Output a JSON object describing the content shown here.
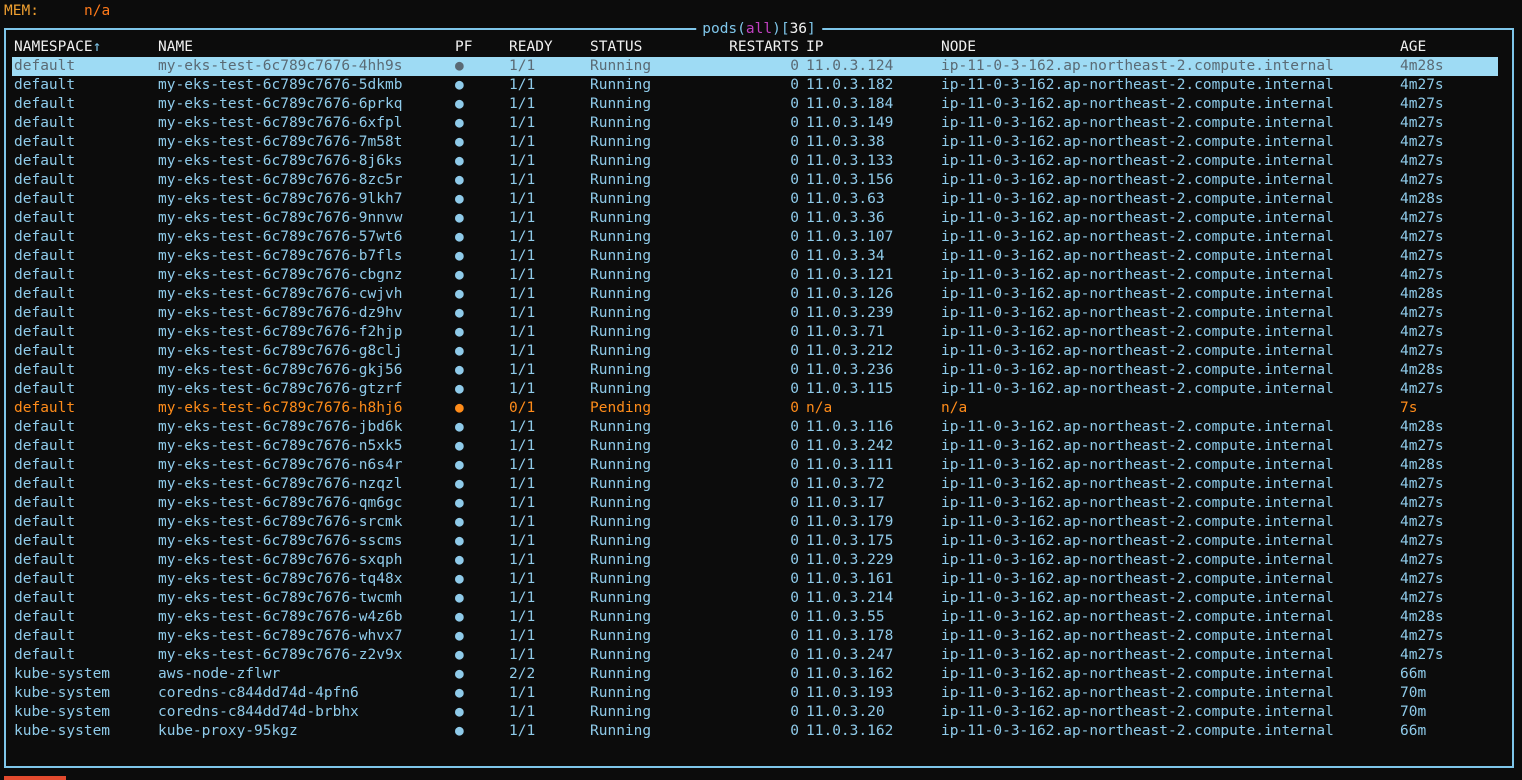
{
  "mem": {
    "label": "MEM:",
    "value": "n/a"
  },
  "title": {
    "resource": "pods",
    "open_paren": "(",
    "scope": "all",
    "close_paren": ")",
    "count_open": "[",
    "count": "36",
    "count_close": "]"
  },
  "colors": {
    "border": "#7fc6ea",
    "running": "#8fcbea",
    "pending": "#ff8c1a",
    "selected_bg": "#9edbf4"
  },
  "columns": {
    "namespace": "NAMESPACE",
    "sort_indicator": "↑",
    "name": "NAME",
    "pf": "PF",
    "ready": "READY",
    "status": "STATUS",
    "restarts": "RESTARTS",
    "ip": "IP",
    "node": "NODE",
    "age": "AGE"
  },
  "pods": [
    {
      "ns": "default",
      "name": "my-eks-test-6c789c7676-4hh9s",
      "pf": "●",
      "ready": "1/1",
      "status": "Running",
      "restarts": "0",
      "ip": "11.0.3.124",
      "node": "ip-11-0-3-162.ap-northeast-2.compute.internal",
      "age": "4m28s",
      "state": "selected"
    },
    {
      "ns": "default",
      "name": "my-eks-test-6c789c7676-5dkmb",
      "pf": "●",
      "ready": "1/1",
      "status": "Running",
      "restarts": "0",
      "ip": "11.0.3.182",
      "node": "ip-11-0-3-162.ap-northeast-2.compute.internal",
      "age": "4m27s",
      "state": "running"
    },
    {
      "ns": "default",
      "name": "my-eks-test-6c789c7676-6prkq",
      "pf": "●",
      "ready": "1/1",
      "status": "Running",
      "restarts": "0",
      "ip": "11.0.3.184",
      "node": "ip-11-0-3-162.ap-northeast-2.compute.internal",
      "age": "4m27s",
      "state": "running"
    },
    {
      "ns": "default",
      "name": "my-eks-test-6c789c7676-6xfpl",
      "pf": "●",
      "ready": "1/1",
      "status": "Running",
      "restarts": "0",
      "ip": "11.0.3.149",
      "node": "ip-11-0-3-162.ap-northeast-2.compute.internal",
      "age": "4m27s",
      "state": "running"
    },
    {
      "ns": "default",
      "name": "my-eks-test-6c789c7676-7m58t",
      "pf": "●",
      "ready": "1/1",
      "status": "Running",
      "restarts": "0",
      "ip": "11.0.3.38",
      "node": "ip-11-0-3-162.ap-northeast-2.compute.internal",
      "age": "4m27s",
      "state": "running"
    },
    {
      "ns": "default",
      "name": "my-eks-test-6c789c7676-8j6ks",
      "pf": "●",
      "ready": "1/1",
      "status": "Running",
      "restarts": "0",
      "ip": "11.0.3.133",
      "node": "ip-11-0-3-162.ap-northeast-2.compute.internal",
      "age": "4m27s",
      "state": "running"
    },
    {
      "ns": "default",
      "name": "my-eks-test-6c789c7676-8zc5r",
      "pf": "●",
      "ready": "1/1",
      "status": "Running",
      "restarts": "0",
      "ip": "11.0.3.156",
      "node": "ip-11-0-3-162.ap-northeast-2.compute.internal",
      "age": "4m27s",
      "state": "running"
    },
    {
      "ns": "default",
      "name": "my-eks-test-6c789c7676-9lkh7",
      "pf": "●",
      "ready": "1/1",
      "status": "Running",
      "restarts": "0",
      "ip": "11.0.3.63",
      "node": "ip-11-0-3-162.ap-northeast-2.compute.internal",
      "age": "4m28s",
      "state": "running"
    },
    {
      "ns": "default",
      "name": "my-eks-test-6c789c7676-9nnvw",
      "pf": "●",
      "ready": "1/1",
      "status": "Running",
      "restarts": "0",
      "ip": "11.0.3.36",
      "node": "ip-11-0-3-162.ap-northeast-2.compute.internal",
      "age": "4m27s",
      "state": "running"
    },
    {
      "ns": "default",
      "name": "my-eks-test-6c789c7676-57wt6",
      "pf": "●",
      "ready": "1/1",
      "status": "Running",
      "restarts": "0",
      "ip": "11.0.3.107",
      "node": "ip-11-0-3-162.ap-northeast-2.compute.internal",
      "age": "4m27s",
      "state": "running"
    },
    {
      "ns": "default",
      "name": "my-eks-test-6c789c7676-b7fls",
      "pf": "●",
      "ready": "1/1",
      "status": "Running",
      "restarts": "0",
      "ip": "11.0.3.34",
      "node": "ip-11-0-3-162.ap-northeast-2.compute.internal",
      "age": "4m27s",
      "state": "running"
    },
    {
      "ns": "default",
      "name": "my-eks-test-6c789c7676-cbgnz",
      "pf": "●",
      "ready": "1/1",
      "status": "Running",
      "restarts": "0",
      "ip": "11.0.3.121",
      "node": "ip-11-0-3-162.ap-northeast-2.compute.internal",
      "age": "4m27s",
      "state": "running"
    },
    {
      "ns": "default",
      "name": "my-eks-test-6c789c7676-cwjvh",
      "pf": "●",
      "ready": "1/1",
      "status": "Running",
      "restarts": "0",
      "ip": "11.0.3.126",
      "node": "ip-11-0-3-162.ap-northeast-2.compute.internal",
      "age": "4m28s",
      "state": "running"
    },
    {
      "ns": "default",
      "name": "my-eks-test-6c789c7676-dz9hv",
      "pf": "●",
      "ready": "1/1",
      "status": "Running",
      "restarts": "0",
      "ip": "11.0.3.239",
      "node": "ip-11-0-3-162.ap-northeast-2.compute.internal",
      "age": "4m27s",
      "state": "running"
    },
    {
      "ns": "default",
      "name": "my-eks-test-6c789c7676-f2hjp",
      "pf": "●",
      "ready": "1/1",
      "status": "Running",
      "restarts": "0",
      "ip": "11.0.3.71",
      "node": "ip-11-0-3-162.ap-northeast-2.compute.internal",
      "age": "4m27s",
      "state": "running"
    },
    {
      "ns": "default",
      "name": "my-eks-test-6c789c7676-g8clj",
      "pf": "●",
      "ready": "1/1",
      "status": "Running",
      "restarts": "0",
      "ip": "11.0.3.212",
      "node": "ip-11-0-3-162.ap-northeast-2.compute.internal",
      "age": "4m27s",
      "state": "running"
    },
    {
      "ns": "default",
      "name": "my-eks-test-6c789c7676-gkj56",
      "pf": "●",
      "ready": "1/1",
      "status": "Running",
      "restarts": "0",
      "ip": "11.0.3.236",
      "node": "ip-11-0-3-162.ap-northeast-2.compute.internal",
      "age": "4m28s",
      "state": "running"
    },
    {
      "ns": "default",
      "name": "my-eks-test-6c789c7676-gtzrf",
      "pf": "●",
      "ready": "1/1",
      "status": "Running",
      "restarts": "0",
      "ip": "11.0.3.115",
      "node": "ip-11-0-3-162.ap-northeast-2.compute.internal",
      "age": "4m27s",
      "state": "running"
    },
    {
      "ns": "default",
      "name": "my-eks-test-6c789c7676-h8hj6",
      "pf": "●",
      "ready": "0/1",
      "status": "Pending",
      "restarts": "0",
      "ip": "n/a",
      "node": "n/a",
      "age": "7s",
      "state": "pending"
    },
    {
      "ns": "default",
      "name": "my-eks-test-6c789c7676-jbd6k",
      "pf": "●",
      "ready": "1/1",
      "status": "Running",
      "restarts": "0",
      "ip": "11.0.3.116",
      "node": "ip-11-0-3-162.ap-northeast-2.compute.internal",
      "age": "4m28s",
      "state": "running"
    },
    {
      "ns": "default",
      "name": "my-eks-test-6c789c7676-n5xk5",
      "pf": "●",
      "ready": "1/1",
      "status": "Running",
      "restarts": "0",
      "ip": "11.0.3.242",
      "node": "ip-11-0-3-162.ap-northeast-2.compute.internal",
      "age": "4m27s",
      "state": "running"
    },
    {
      "ns": "default",
      "name": "my-eks-test-6c789c7676-n6s4r",
      "pf": "●",
      "ready": "1/1",
      "status": "Running",
      "restarts": "0",
      "ip": "11.0.3.111",
      "node": "ip-11-0-3-162.ap-northeast-2.compute.internal",
      "age": "4m28s",
      "state": "running"
    },
    {
      "ns": "default",
      "name": "my-eks-test-6c789c7676-nzqzl",
      "pf": "●",
      "ready": "1/1",
      "status": "Running",
      "restarts": "0",
      "ip": "11.0.3.72",
      "node": "ip-11-0-3-162.ap-northeast-2.compute.internal",
      "age": "4m27s",
      "state": "running"
    },
    {
      "ns": "default",
      "name": "my-eks-test-6c789c7676-qm6gc",
      "pf": "●",
      "ready": "1/1",
      "status": "Running",
      "restarts": "0",
      "ip": "11.0.3.17",
      "node": "ip-11-0-3-162.ap-northeast-2.compute.internal",
      "age": "4m27s",
      "state": "running"
    },
    {
      "ns": "default",
      "name": "my-eks-test-6c789c7676-srcmk",
      "pf": "●",
      "ready": "1/1",
      "status": "Running",
      "restarts": "0",
      "ip": "11.0.3.179",
      "node": "ip-11-0-3-162.ap-northeast-2.compute.internal",
      "age": "4m27s",
      "state": "running"
    },
    {
      "ns": "default",
      "name": "my-eks-test-6c789c7676-sscms",
      "pf": "●",
      "ready": "1/1",
      "status": "Running",
      "restarts": "0",
      "ip": "11.0.3.175",
      "node": "ip-11-0-3-162.ap-northeast-2.compute.internal",
      "age": "4m27s",
      "state": "running"
    },
    {
      "ns": "default",
      "name": "my-eks-test-6c789c7676-sxqph",
      "pf": "●",
      "ready": "1/1",
      "status": "Running",
      "restarts": "0",
      "ip": "11.0.3.229",
      "node": "ip-11-0-3-162.ap-northeast-2.compute.internal",
      "age": "4m27s",
      "state": "running"
    },
    {
      "ns": "default",
      "name": "my-eks-test-6c789c7676-tq48x",
      "pf": "●",
      "ready": "1/1",
      "status": "Running",
      "restarts": "0",
      "ip": "11.0.3.161",
      "node": "ip-11-0-3-162.ap-northeast-2.compute.internal",
      "age": "4m27s",
      "state": "running"
    },
    {
      "ns": "default",
      "name": "my-eks-test-6c789c7676-twcmh",
      "pf": "●",
      "ready": "1/1",
      "status": "Running",
      "restarts": "0",
      "ip": "11.0.3.214",
      "node": "ip-11-0-3-162.ap-northeast-2.compute.internal",
      "age": "4m27s",
      "state": "running"
    },
    {
      "ns": "default",
      "name": "my-eks-test-6c789c7676-w4z6b",
      "pf": "●",
      "ready": "1/1",
      "status": "Running",
      "restarts": "0",
      "ip": "11.0.3.55",
      "node": "ip-11-0-3-162.ap-northeast-2.compute.internal",
      "age": "4m28s",
      "state": "running"
    },
    {
      "ns": "default",
      "name": "my-eks-test-6c789c7676-whvx7",
      "pf": "●",
      "ready": "1/1",
      "status": "Running",
      "restarts": "0",
      "ip": "11.0.3.178",
      "node": "ip-11-0-3-162.ap-northeast-2.compute.internal",
      "age": "4m27s",
      "state": "running"
    },
    {
      "ns": "default",
      "name": "my-eks-test-6c789c7676-z2v9x",
      "pf": "●",
      "ready": "1/1",
      "status": "Running",
      "restarts": "0",
      "ip": "11.0.3.247",
      "node": "ip-11-0-3-162.ap-northeast-2.compute.internal",
      "age": "4m27s",
      "state": "running"
    },
    {
      "ns": "kube-system",
      "name": "aws-node-zflwr",
      "pf": "●",
      "ready": "2/2",
      "status": "Running",
      "restarts": "0",
      "ip": "11.0.3.162",
      "node": "ip-11-0-3-162.ap-northeast-2.compute.internal",
      "age": "66m",
      "state": "running"
    },
    {
      "ns": "kube-system",
      "name": "coredns-c844dd74d-4pfn6",
      "pf": "●",
      "ready": "1/1",
      "status": "Running",
      "restarts": "0",
      "ip": "11.0.3.193",
      "node": "ip-11-0-3-162.ap-northeast-2.compute.internal",
      "age": "70m",
      "state": "running"
    },
    {
      "ns": "kube-system",
      "name": "coredns-c844dd74d-brbhx",
      "pf": "●",
      "ready": "1/1",
      "status": "Running",
      "restarts": "0",
      "ip": "11.0.3.20",
      "node": "ip-11-0-3-162.ap-northeast-2.compute.internal",
      "age": "70m",
      "state": "running"
    },
    {
      "ns": "kube-system",
      "name": "kube-proxy-95kgz",
      "pf": "●",
      "ready": "1/1",
      "status": "Running",
      "restarts": "0",
      "ip": "11.0.3.162",
      "node": "ip-11-0-3-162.ap-northeast-2.compute.internal",
      "age": "66m",
      "state": "running"
    }
  ]
}
